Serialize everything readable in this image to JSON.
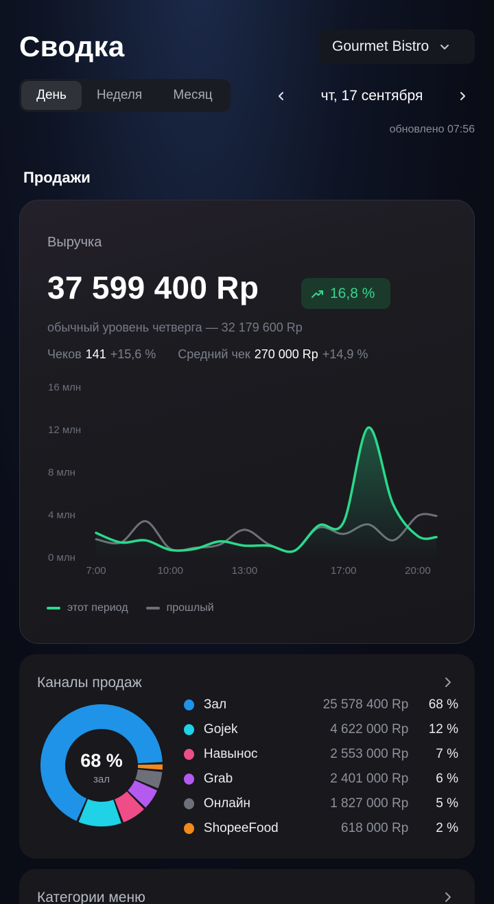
{
  "header": {
    "title": "Сводка",
    "venue": "Gourmet Bistro",
    "periods": [
      "День",
      "Неделя",
      "Месяц"
    ],
    "active_period": "День",
    "date": "чт, 17 сентября",
    "updated": "обновлено 07:56"
  },
  "sales": {
    "section_title": "Продажи",
    "revenue_label": "Выручка",
    "revenue_value": "37 599 400 Rp",
    "change_badge": "16,8 %",
    "baseline": "обычный уровень четверга — 32 179 600 Rp",
    "checks_label": "Чеков",
    "checks_value": "141",
    "checks_change": "+15,6 %",
    "avg_label": "Средний чек",
    "avg_value": "270 000 Rp",
    "avg_change": "+14,9 %",
    "legend_current": "этот период",
    "legend_previous": "прошлый"
  },
  "chart_data": {
    "type": "line",
    "y_ticks": [
      "16 млн",
      "12 млн",
      "8 млн",
      "4 млн",
      "0 млн"
    ],
    "x_ticks": [
      "7:00",
      "10:00",
      "13:00",
      "17:00",
      "20:00"
    ],
    "ylim": [
      0,
      16
    ],
    "y_unit": "млн",
    "x": [
      7.0,
      8.0,
      9.0,
      10.0,
      11.0,
      12.0,
      13.0,
      14.0,
      15.0,
      16.0,
      17.0,
      18.0,
      19.0,
      20.0,
      20.75
    ],
    "series": [
      {
        "name": "этот период",
        "color": "#2bd98c",
        "values": [
          2.3,
          1.4,
          1.6,
          0.7,
          0.8,
          1.5,
          1.1,
          1.1,
          0.6,
          3.0,
          3.3,
          12.2,
          5.0,
          2.0,
          1.9
        ]
      },
      {
        "name": "прошлый",
        "color": "#6e7078",
        "values": [
          1.7,
          1.4,
          3.4,
          0.8,
          0.9,
          1.2,
          2.6,
          1.2,
          0.6,
          2.8,
          2.2,
          3.1,
          1.6,
          3.9,
          3.9
        ]
      }
    ],
    "grid": false,
    "legend": "bottom-left"
  },
  "channels": {
    "title": "Каналы продаж",
    "center_pct": "68 %",
    "center_label": "зал",
    "items": [
      {
        "name": "Зал",
        "amount": "25 578 400 Rp",
        "pct": "68 %",
        "share": 68,
        "color": "#1e93e8"
      },
      {
        "name": "Gojek",
        "amount": "4 622 000 Rp",
        "pct": "12 %",
        "share": 12,
        "color": "#1fd2e6"
      },
      {
        "name": "Навынос",
        "amount": "2 553 000 Rp",
        "pct": "7 %",
        "share": 7,
        "color": "#ef4d88"
      },
      {
        "name": "Grab",
        "amount": "2 401 000 Rp",
        "pct": "6 %",
        "share": 6,
        "color": "#b55af0"
      },
      {
        "name": "Онлайн",
        "amount": "1 827 000 Rp",
        "pct": "5 %",
        "share": 5,
        "color": "#6d7079"
      },
      {
        "name": "ShopeeFood",
        "amount": "618 000 Rp",
        "pct": "2 %",
        "share": 2,
        "color": "#f18a1a"
      }
    ]
  },
  "menu_categories": {
    "title": "Категории меню"
  },
  "colors": {
    "accent_green": "#2bd98c",
    "badge_bg": "#1b3a2c"
  },
  "icons": {
    "venue_chevron": "chevron-down-icon",
    "prev": "chevron-left-icon",
    "next": "chevron-right-icon",
    "trend": "trending-up-icon"
  }
}
